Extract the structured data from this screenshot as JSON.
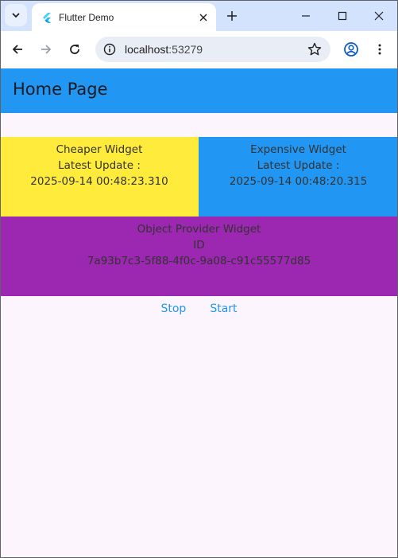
{
  "browser": {
    "tab_title": "Flutter Demo",
    "url_host": "localhost",
    "url_port": ":53279"
  },
  "app": {
    "title": "Home Page"
  },
  "cheaper": {
    "title": "Cheaper Widget",
    "label": "Latest Update :",
    "timestamp": "2025-09-14 00:48:23.310",
    "color": "#ffeb3b"
  },
  "expensive": {
    "title": "Expensive Widget",
    "label": "Latest Update :",
    "timestamp": "2025-09-14 00:48:20.315",
    "color": "#2196f3"
  },
  "object_provider": {
    "title": "Object Provider Widget",
    "id_label": "ID",
    "id_value": "7a93b7c3-5f88-4f0c-9a08-c91c55577d85",
    "color": "#9c27b0"
  },
  "actions": {
    "stop_label": "Stop",
    "start_label": "Start"
  },
  "icons": [
    "chevron-down-icon",
    "flutter-logo-icon",
    "close-icon",
    "plus-icon",
    "minimize-icon",
    "maximize-icon",
    "back-icon",
    "forward-icon",
    "reload-icon",
    "info-icon",
    "star-icon",
    "profile-icon",
    "menu-icon"
  ]
}
